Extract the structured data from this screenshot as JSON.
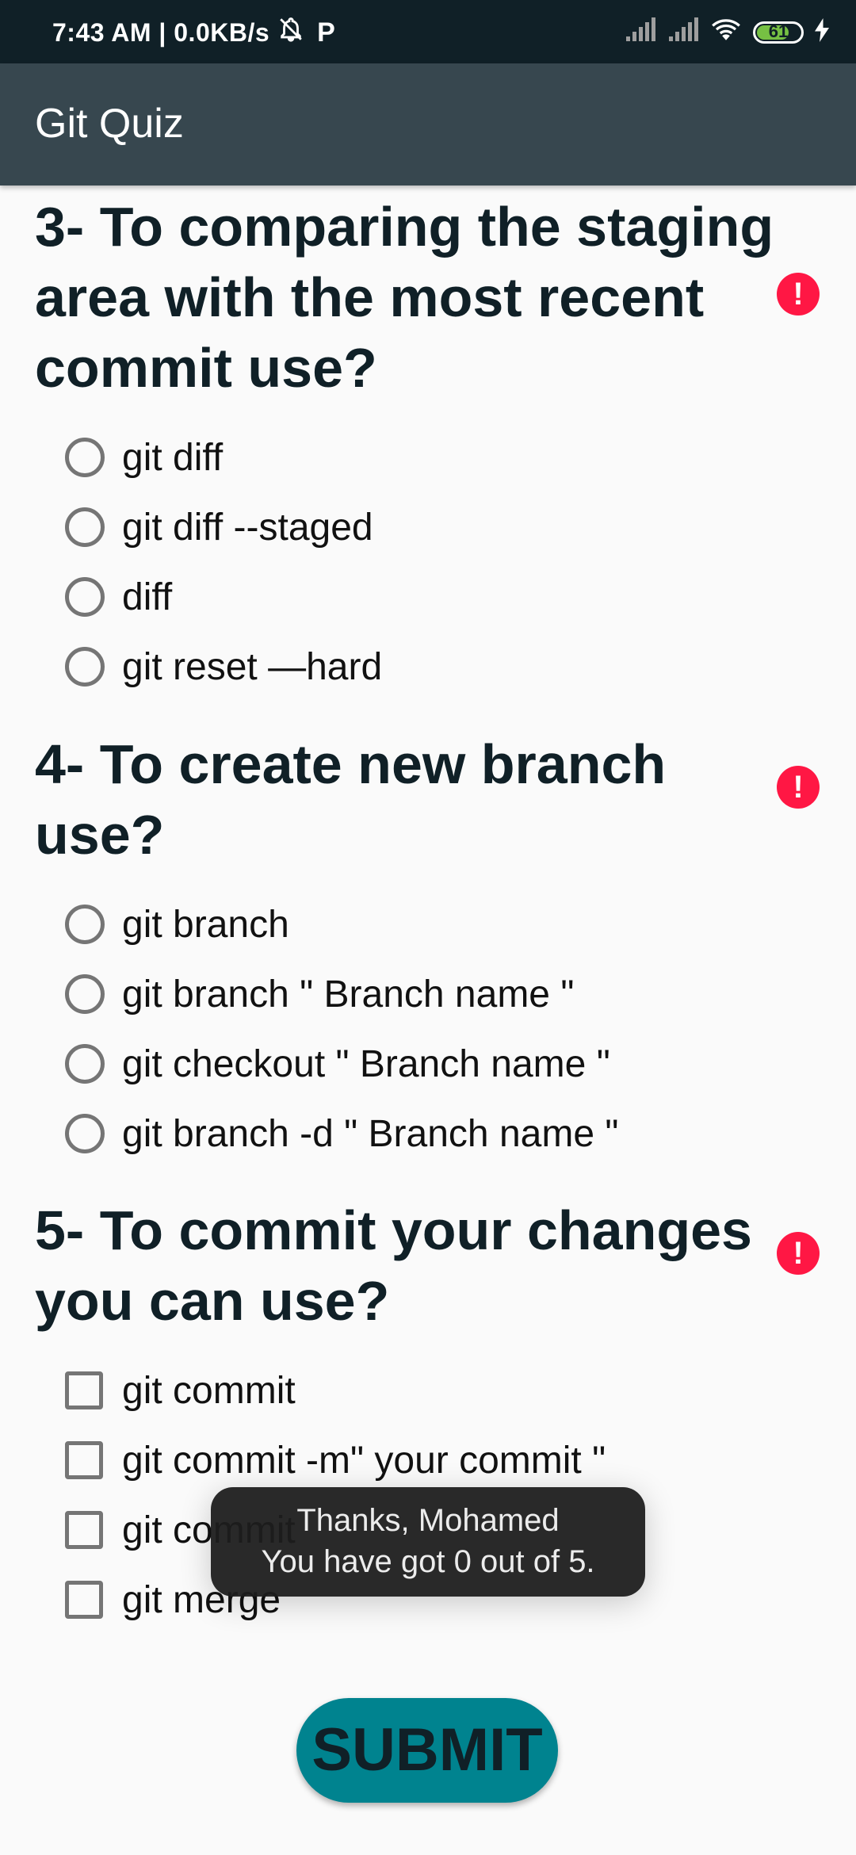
{
  "status_bar": {
    "time_text": "7:43 AM | 0.0KB/s",
    "battery": "61",
    "icons": [
      "mute-alarm-icon",
      "p-icon",
      "signal-icon",
      "signal-icon",
      "wifi-icon",
      "battery-icon",
      "charging-icon"
    ]
  },
  "app_bar": {
    "title": "Git Quiz"
  },
  "questions": [
    {
      "title": "3- To comparing the staging area with the most recent commit use?",
      "type": "radio",
      "options": [
        "git diff",
        "git diff --staged",
        "diff",
        "git reset —hard"
      ]
    },
    {
      "title": "4- To create new branch use?",
      "type": "radio",
      "options": [
        "git branch",
        "git branch \" Branch name \"",
        "git checkout \" Branch name \"",
        "git branch -d \" Branch name \""
      ]
    },
    {
      "title": "5- To commit your changes you can use?",
      "type": "checkbox",
      "options": [
        "git commit",
        "git commit -m\" your commit \"",
        "git commit",
        "git merge"
      ]
    }
  ],
  "error_icon": "!",
  "toast": {
    "line1": "Thanks, Mohamed",
    "line2": "You have got 0 out of 5."
  },
  "submit_label": "SUBMIT",
  "colors": {
    "status_bar": "#102027",
    "app_bar": "#37474f",
    "error": "#ff1744",
    "submit": "#00838f"
  }
}
